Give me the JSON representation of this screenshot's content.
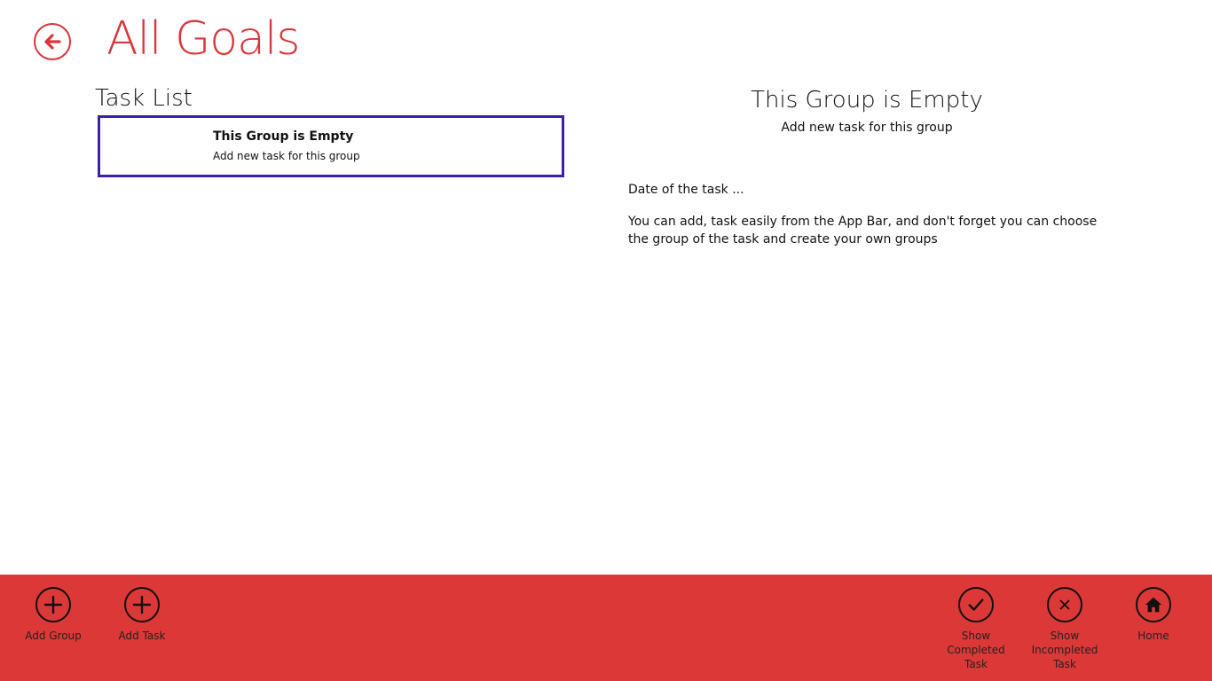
{
  "header": {
    "back_icon": "back-arrow-icon",
    "title": "All Goals"
  },
  "task_list": {
    "title": "Task List",
    "items": [
      {
        "title": "This Group is Empty",
        "subtitle": "Add new task for this group"
      }
    ]
  },
  "detail": {
    "title": "This Group is Empty",
    "subtitle": "Add new task for this group",
    "date": "Date of the task ...",
    "description": "You can add, task easily from the App Bar, and don't forget you can choose the group of the task and create your own groups"
  },
  "app_bar": {
    "color": "#dc3838",
    "buttons": [
      {
        "label": "Add Group",
        "icon": "plus-icon"
      },
      {
        "label": "Add Task",
        "icon": "plus-icon"
      },
      {
        "label": "Show Completed Task",
        "icon": "check-icon"
      },
      {
        "label": "Show Incompleted Task",
        "icon": "close-icon"
      },
      {
        "label": "Home",
        "icon": "home-icon"
      }
    ]
  },
  "colors": {
    "accent": "#d8363a",
    "selection_border": "#3d1fa8"
  }
}
